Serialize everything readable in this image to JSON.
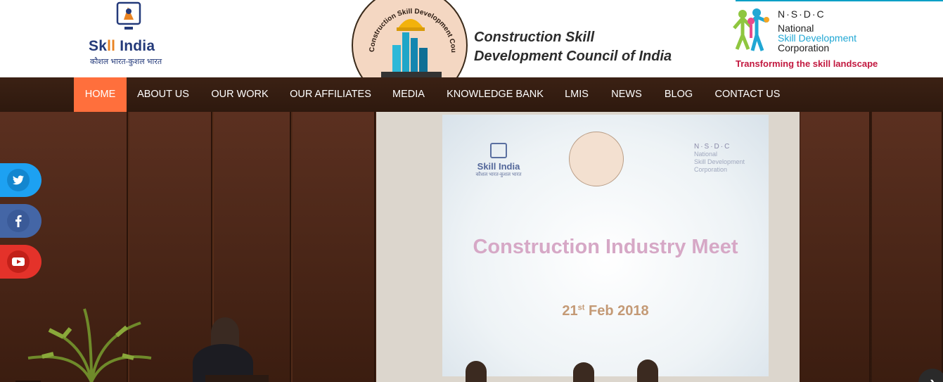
{
  "header": {
    "skill_india": {
      "brand_pre": "Sk",
      "brand_ii": "ll",
      "brand_post": " India",
      "tagline": "कौशल भारत-कुशल भारत"
    },
    "council_seal_text": "Construction Skill Development Council",
    "council_title_line1": "Construction Skill",
    "council_title_line2": "Development Council of India",
    "nsdc": {
      "dots": "N·S·D·C",
      "line1": "National",
      "line2": "Skill Development",
      "line3": "Corporation",
      "slogan": "Transforming the skill landscape"
    }
  },
  "nav": {
    "items": [
      {
        "label": "HOME",
        "active": true
      },
      {
        "label": "ABOUT US",
        "active": false
      },
      {
        "label": "OUR WORK",
        "active": false
      },
      {
        "label": "OUR AFFILIATES",
        "active": false
      },
      {
        "label": "MEDIA",
        "active": false
      },
      {
        "label": "KNOWLEDGE BANK",
        "active": false
      },
      {
        "label": "LMIS",
        "active": false
      },
      {
        "label": "NEWS",
        "active": false
      },
      {
        "label": "BLOG",
        "active": false
      },
      {
        "label": "CONTACT US",
        "active": false
      }
    ]
  },
  "hero": {
    "screen_skill": "Skill India",
    "screen_skill_tag": "कौशल भारत-कुशल भारत",
    "screen_nsdc_dots": "N·S·D·C",
    "screen_nsdc_l1": "National",
    "screen_nsdc_l2": "Skill Development",
    "screen_nsdc_l3": "Corporation",
    "screen_title": "Construction Industry Meet",
    "screen_date_day": "21",
    "screen_date_sup": "st",
    "screen_date_rest": " Feb 2018"
  },
  "social": {
    "twitter_icon": "twitter-icon",
    "facebook_icon": "facebook-icon",
    "youtube_icon": "youtube-icon"
  },
  "carousel": {
    "next_icon": "chevron-right-icon"
  },
  "colors": {
    "nav_bg": "#3b2114",
    "nav_active": "#ff6f3c",
    "twitter": "#1da1f2",
    "facebook": "#4466a6",
    "youtube": "#e4322a"
  }
}
